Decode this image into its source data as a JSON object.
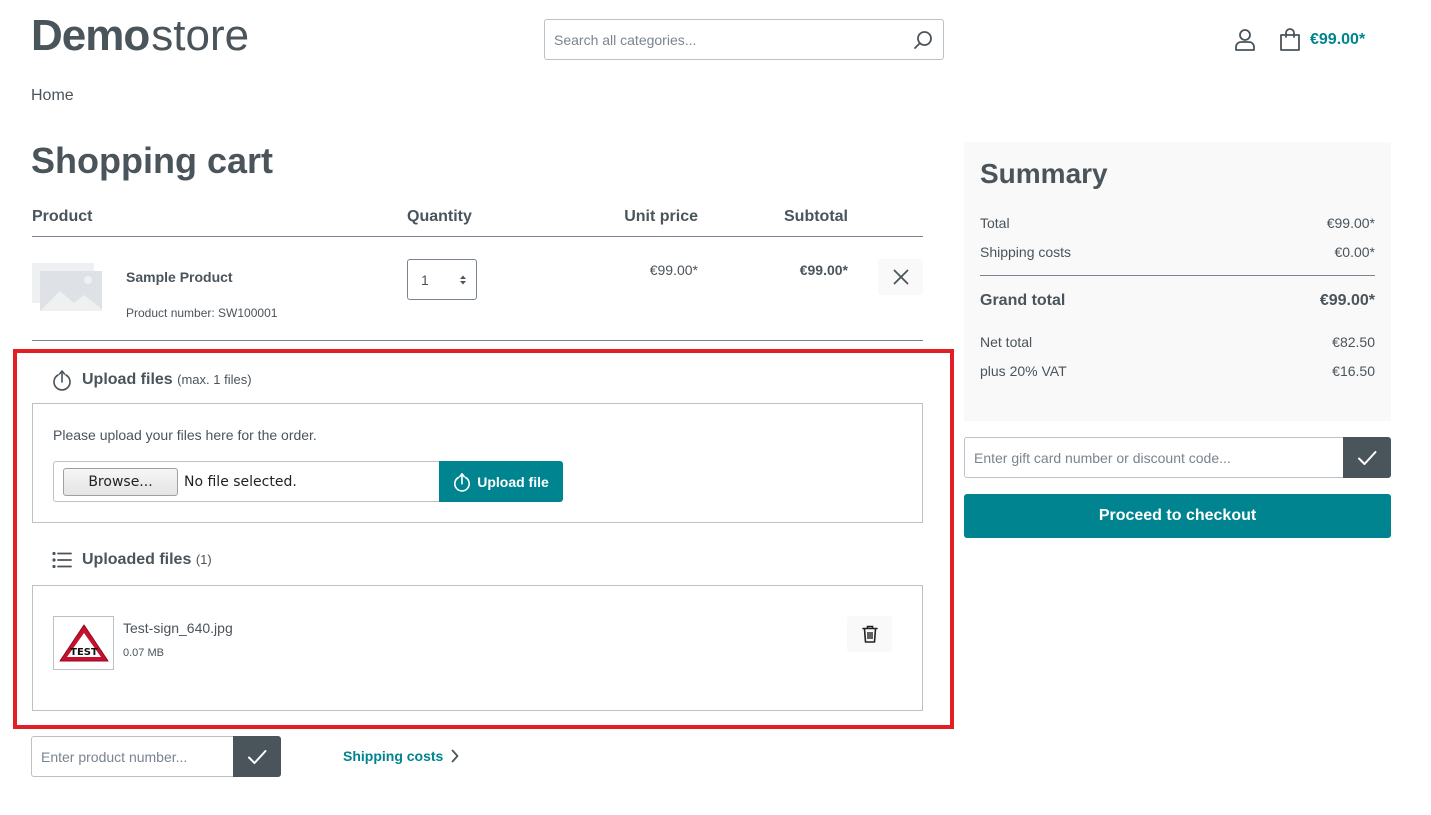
{
  "header": {
    "logo_bold": "Demo",
    "logo_light": "store",
    "search_placeholder": "Search all categories...",
    "cart_total": "€99.00*"
  },
  "breadcrumb": "Home",
  "cart": {
    "title": "Shopping cart",
    "columns": {
      "product": "Product",
      "quantity": "Quantity",
      "unit_price": "Unit price",
      "subtotal": "Subtotal"
    },
    "item": {
      "name": "Sample Product",
      "number": "Product number: SW100001",
      "quantity": "1",
      "unit_price": "€99.00*",
      "subtotal": "€99.00*"
    }
  },
  "upload": {
    "title": "Upload files",
    "note": "(max. 1 files)",
    "instruction": "Please upload your files here for the order.",
    "browse_label": "Browse...",
    "file_status": "No file selected.",
    "upload_button": "Upload file"
  },
  "uploaded": {
    "title": "Uploaded files",
    "count": "(1)",
    "files": [
      {
        "name": "Test-sign_640.jpg",
        "size": "0.07 MB",
        "thumb_text": "TEST"
      }
    ]
  },
  "product_number_placeholder": "Enter product number...",
  "shipping_link": "Shipping costs",
  "summary": {
    "title": "Summary",
    "total_label": "Total",
    "total_value": "€99.00*",
    "shipping_label": "Shipping costs",
    "shipping_value": "€0.00*",
    "grand_label": "Grand total",
    "grand_value": "€99.00*",
    "net_label": "Net total",
    "net_value": "€82.50",
    "vat_label": "plus 20% VAT",
    "vat_value": "€16.50"
  },
  "voucher_placeholder": "Enter gift card number or discount code...",
  "checkout_button": "Proceed to checkout",
  "colors": {
    "primary": "#008490",
    "text": "#4a545b",
    "highlight": "#e31e24"
  }
}
